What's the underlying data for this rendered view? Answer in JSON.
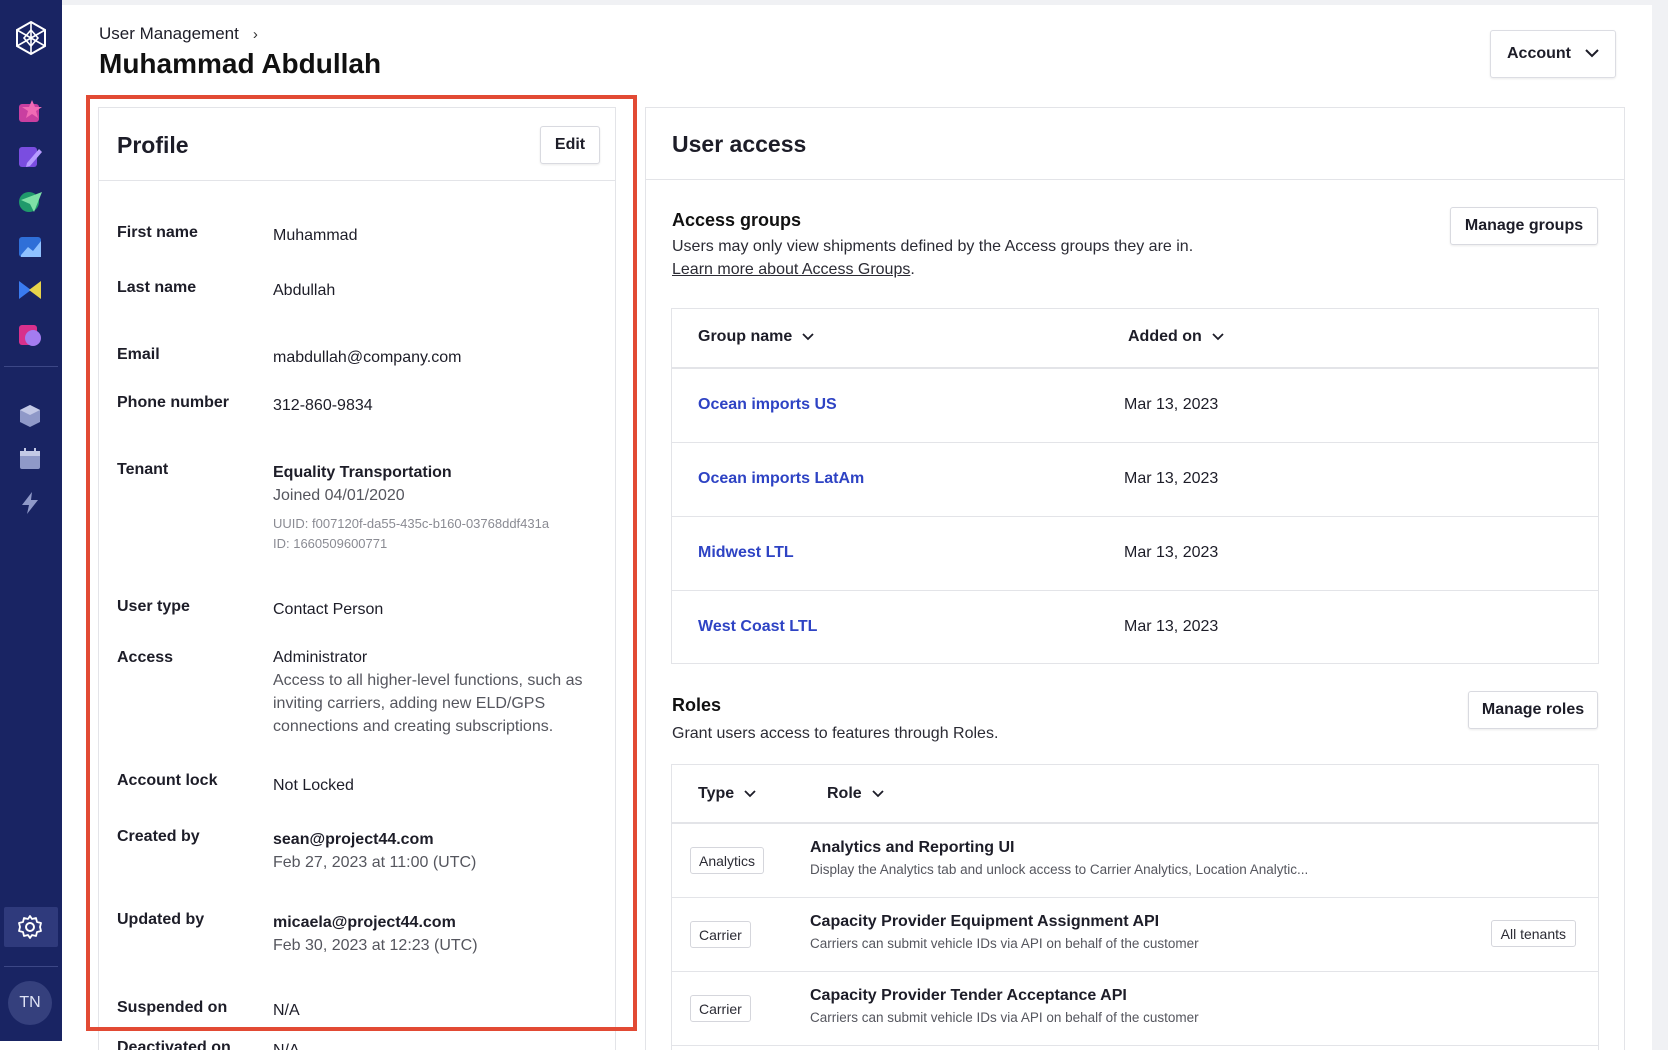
{
  "breadcrumb": {
    "parent": "User Management",
    "separator": "›"
  },
  "page_title": "Muhammad Abdullah",
  "header": {
    "account_label": "Account"
  },
  "nav": {
    "avatar_initials": "TN",
    "icons": [
      "logo-icon",
      "star-app-icon",
      "pen-app-icon",
      "send-app-icon",
      "chart-app-icon",
      "flag-app-icon",
      "pie-app-icon",
      "box-icon",
      "calendar-icon",
      "lightning-icon",
      "settings-icon"
    ]
  },
  "profile": {
    "title": "Profile",
    "edit_label": "Edit",
    "fields": {
      "first_name": {
        "label": "First name",
        "value": "Muhammad"
      },
      "last_name": {
        "label": "Last name",
        "value": "Abdullah"
      },
      "email": {
        "label": "Email",
        "value": "mabdullah@company.com"
      },
      "phone": {
        "label": "Phone number",
        "value": "312-860-9834"
      },
      "tenant": {
        "label": "Tenant",
        "name": "Equality Transportation",
        "joined": "Joined 04/01/2020",
        "uuid": "UUID: f007120f-da55-435c-b160-03768ddf431a",
        "id": "ID: 1660509600771"
      },
      "user_type": {
        "label": "User type",
        "value": "Contact Person"
      },
      "access": {
        "label": "Access",
        "value": "Administrator",
        "description": "Access to all higher-level functions, such as inviting carriers, adding new ELD/GPS connections and creating subscriptions."
      },
      "account_lock": {
        "label": "Account lock",
        "value": "Not Locked"
      },
      "created_by": {
        "label": "Created by",
        "value": "sean@project44.com",
        "time": "Feb 27, 2023 at 11:00 (UTC)"
      },
      "updated_by": {
        "label": "Updated by",
        "value": "micaela@project44.com",
        "time": "Feb 30, 2023 at 12:23 (UTC)"
      },
      "suspended_on": {
        "label": "Suspended on",
        "value": "N/A"
      },
      "deactivated_on": {
        "label": "Deactivated on",
        "value": "N/A"
      }
    }
  },
  "user_access": {
    "title": "User access",
    "access_groups": {
      "title": "Access groups",
      "description": "Users may only view shipments defined by the Access groups they are in.",
      "link": "Learn more about Access Groups",
      "link_suffix": ".",
      "manage_label": "Manage groups",
      "columns": [
        "Group name",
        "Added on"
      ],
      "rows": [
        {
          "name": "Ocean imports US",
          "added_on": "Mar 13, 2023"
        },
        {
          "name": "Ocean imports LatAm",
          "added_on": "Mar 13, 2023"
        },
        {
          "name": "Midwest LTL",
          "added_on": "Mar 13, 2023"
        },
        {
          "name": "West Coast LTL",
          "added_on": "Mar 13, 2023"
        }
      ]
    },
    "roles": {
      "title": "Roles",
      "description": "Grant users access to features through Roles.",
      "manage_label": "Manage roles",
      "columns": [
        "Type",
        "Role"
      ],
      "rows": [
        {
          "type": "Analytics",
          "name": "Analytics and Reporting UI",
          "description": "Display the Analytics tab and unlock access to Carrier Analytics, Location Analytic...",
          "scope": ""
        },
        {
          "type": "Carrier",
          "name": "Capacity Provider Equipment Assignment API",
          "description": "Carriers can submit vehicle IDs via API on behalf of the customer",
          "scope": "All tenants"
        },
        {
          "type": "Carrier",
          "name": "Capacity Provider Tender Acceptance API",
          "description": "Carriers can submit vehicle IDs via API on behalf of the customer",
          "scope": ""
        }
      ]
    }
  },
  "colors": {
    "nav_bg": "#192463",
    "link": "#2e43c4",
    "highlight_border": "#e24a34"
  }
}
